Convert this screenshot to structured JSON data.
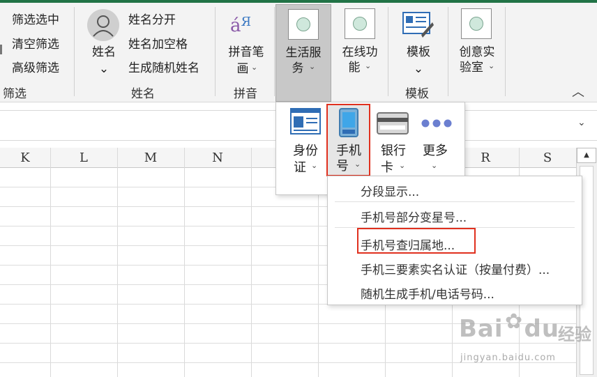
{
  "ribbon": {
    "filter": {
      "items": [
        "筛选选中",
        "清空筛选",
        "高级筛选"
      ],
      "group_label": "筛选"
    },
    "name": {
      "big_label": "姓名",
      "items": [
        "姓名分开",
        "姓名加空格",
        "生成随机姓名"
      ],
      "group_label": "姓名"
    },
    "pinyin": {
      "label_line1": "拼音笔",
      "label_line2": "画",
      "group_label": "拼音"
    },
    "life": {
      "label_line1": "生活服",
      "label_line2": "务"
    },
    "online": {
      "label_line1": "在线功",
      "label_line2": "能"
    },
    "template": {
      "label": "模板",
      "group_label": "模板"
    },
    "creative": {
      "label_line1": "创意实",
      "label_line2": "验室"
    },
    "collapse_glyph": "︿"
  },
  "columns": [
    "K",
    "L",
    "M",
    "N",
    "R",
    "S"
  ],
  "panel": {
    "buttons": [
      {
        "line1": "身份",
        "line2": "证"
      },
      {
        "line1": "手机",
        "line2": "号"
      },
      {
        "line1": "银行",
        "line2": "卡"
      },
      {
        "line1": "更多",
        "line2": ""
      }
    ]
  },
  "menu": {
    "items": [
      "分段显示...",
      "手机号部分变星号...",
      "手机号查归属地...",
      "手机三要素实名认证（按量付费）...",
      "随机生成手机/电话号码..."
    ]
  },
  "watermark": {
    "brand": "Bai",
    "brand2": "du",
    "cn": "经验",
    "url": "jingyan.baidu.com"
  },
  "colors": {
    "accent_green": "#217346",
    "highlight_red": "#e0301e"
  }
}
